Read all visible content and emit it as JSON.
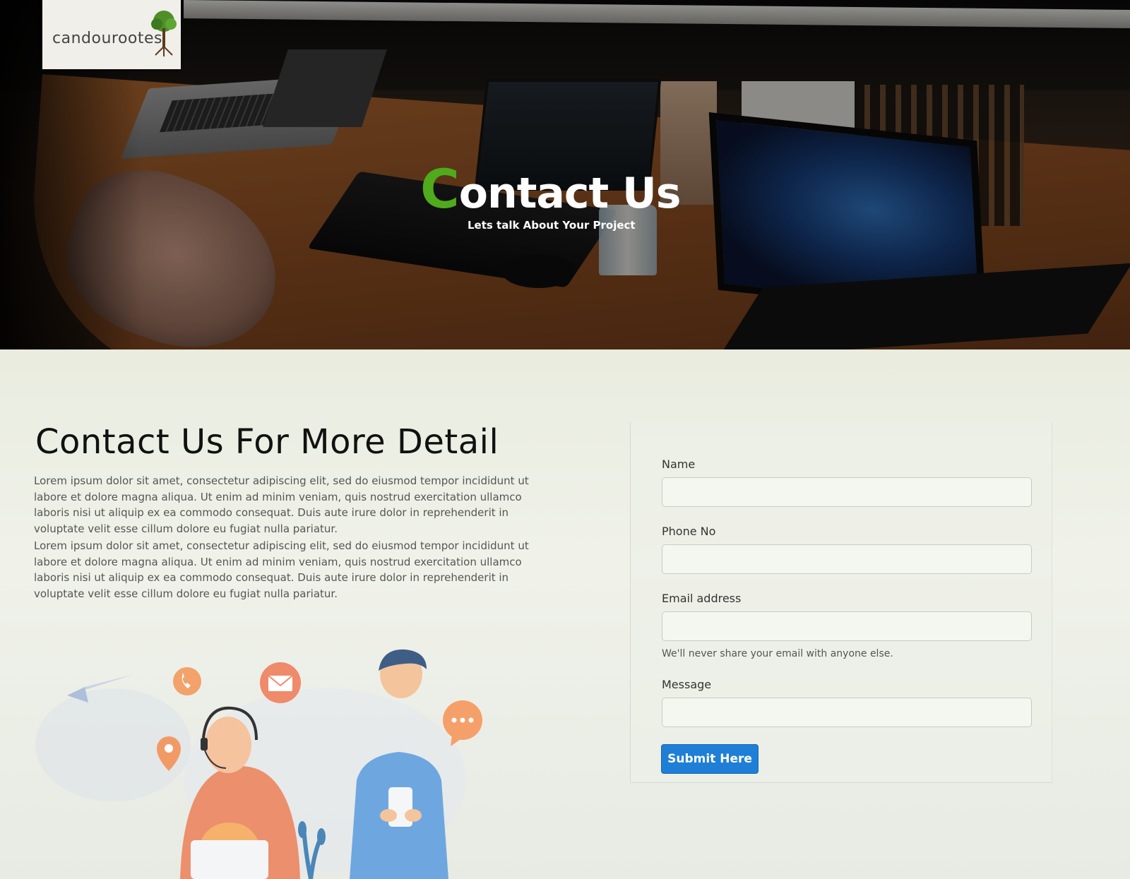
{
  "header": {
    "logo_text": "candourootes",
    "hero_title_first": "C",
    "hero_title_rest": "ontact Us",
    "hero_subtitle": "Lets talk About Your Project"
  },
  "main": {
    "heading": "Contact Us For More Detail",
    "paragraphs": [
      "Lorem ipsum dolor sit amet, consectetur adipiscing elit, sed do eiusmod tempor incididunt ut labore et dolore magna aliqua. Ut enim ad minim veniam, quis nostrud exercitation ullamco laboris nisi ut aliquip ex ea commodo consequat. Duis aute irure dolor in reprehenderit in voluptate velit esse cillum dolore eu fugiat nulla pariatur.",
      "Lorem ipsum dolor sit amet, consectetur adipiscing elit, sed do eiusmod tempor incididunt ut labore et dolore magna aliqua. Ut enim ad minim veniam, quis nostrud exercitation ullamco laboris nisi ut aliquip ex ea commodo consequat. Duis aute irure dolor in reprehenderit in voluptate velit esse cillum dolore eu fugiat nulla pariatur."
    ]
  },
  "form": {
    "name_label": "Name",
    "phone_label": "Phone No",
    "email_label": "Email address",
    "email_help": "We'll never share your email with anyone else.",
    "message_label": "Message",
    "submit_label": "Submit Here"
  },
  "icons": {
    "logo": "tree-icon",
    "phone": "phone-icon",
    "mail": "mail-icon",
    "location": "location-pin-icon",
    "chat": "chat-bubble-icon"
  },
  "colors": {
    "accent_green": "#4faa1c",
    "button_blue": "#1f7fd6",
    "heading_text": "#111111",
    "body_text": "#555555"
  }
}
